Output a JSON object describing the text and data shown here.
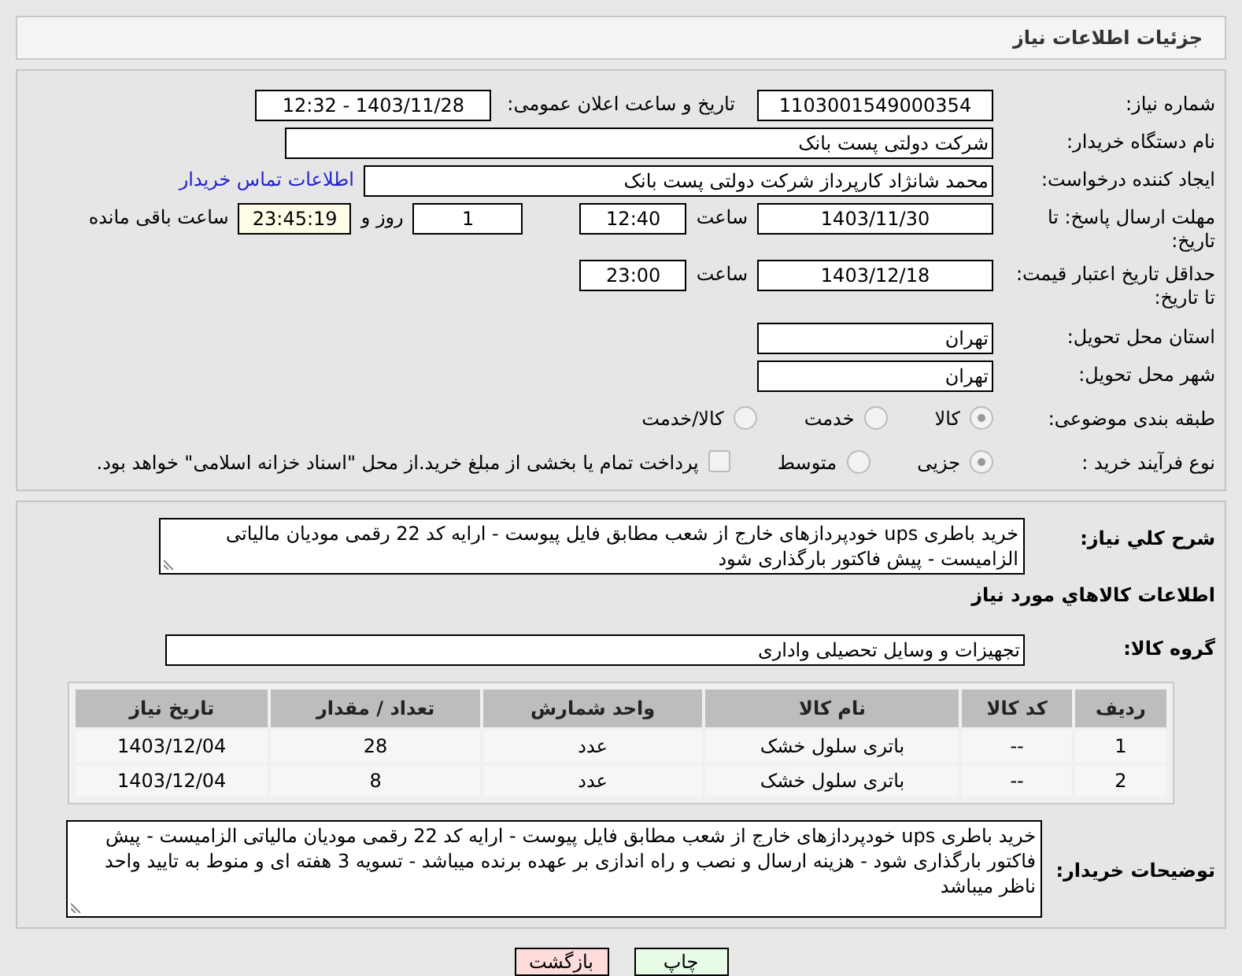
{
  "header": {
    "title": "جزئیات اطلاعات نیاز"
  },
  "need_number": {
    "label": "شماره نیاز:",
    "value": "1103001549000354"
  },
  "announce": {
    "label": "تاریخ و ساعت اعلان عمومی:",
    "value": "1403/11/28 - 12:32"
  },
  "buyer_org": {
    "label": "نام دستگاه خریدار:",
    "value": "شرکت دولتی پست بانک"
  },
  "creator": {
    "label": "ایجاد کننده درخواست:",
    "value": "محمد شانژاد کارپرداز شرکت دولتی پست بانک",
    "link": "اطلاعات تماس خریدار"
  },
  "deadline": {
    "label": "مهلت ارسال پاسخ: تا تاریخ:",
    "date": "1403/11/30",
    "time_label": "ساعت",
    "time": "12:40",
    "days": "1",
    "days_label": "روز و",
    "remaining": "23:45:19",
    "remaining_label": "ساعت باقی مانده"
  },
  "validity": {
    "label": "حداقل تاریخ اعتبار قیمت: تا تاریخ:",
    "date": "1403/12/18",
    "time_label": "ساعت",
    "time": "23:00"
  },
  "province": {
    "label": "استان محل تحویل:",
    "value": "تهران"
  },
  "city": {
    "label": "شهر محل تحویل:",
    "value": "تهران"
  },
  "category": {
    "label": "طبقه بندی موضوعی:",
    "options": [
      {
        "label": "کالا",
        "selected": true
      },
      {
        "label": "خدمت",
        "selected": false
      },
      {
        "label": "کالا/خدمت",
        "selected": false
      }
    ]
  },
  "process": {
    "label": "نوع فرآیند خرید :",
    "options": [
      {
        "label": "جزیی",
        "selected": true
      },
      {
        "label": "متوسط",
        "selected": false
      }
    ],
    "treasury": {
      "checked": false,
      "label": "پرداخت تمام یا بخشی از مبلغ خرید.از محل \"اسناد خزانه اسلامی\" خواهد بود."
    }
  },
  "description": {
    "label": "شرح کلي نياز:",
    "value": "خرید باطری ups خودپردازهای خارج از شعب مطابق فایل پیوست - ارایه کد 22 رقمی مودیان مالیاتی الزامیست - پیش فاکتور بارگذاری شود"
  },
  "goods_heading": "اطلاعات کالاهاي مورد نياز",
  "goods_group": {
    "label": "گروه کالا:",
    "value": "تجهیزات و وسایل تحصیلی واداری"
  },
  "table": {
    "columns": [
      "ردیف",
      "کد کالا",
      "نام کالا",
      "واحد شمارش",
      "تعداد / مقدار",
      "تاریخ نیاز"
    ],
    "rows": [
      [
        "1",
        "--",
        "باتری سلول خشک",
        "عدد",
        "28",
        "1403/12/04"
      ],
      [
        "2",
        "--",
        "باتری سلول خشک",
        "عدد",
        "8",
        "1403/12/04"
      ]
    ]
  },
  "buyer_notes": {
    "label": "توضیحات خریدار:",
    "value": "خرید باطری ups خودپردازهای خارج از شعب مطابق فایل پیوست - ارایه کد 22 رقمی مودیان مالیاتی الزامیست - پیش فاکتور بارگذاری شود - هزینه ارسال و نصب و راه اندازی بر عهده برنده میباشد - تسویه 3 هفته ای و منوط به تایید  واحد ناظر میباشد"
  },
  "buttons": [
    {
      "kind": "print",
      "label": "چاپ"
    },
    {
      "kind": "back",
      "label": "بازگشت"
    }
  ]
}
